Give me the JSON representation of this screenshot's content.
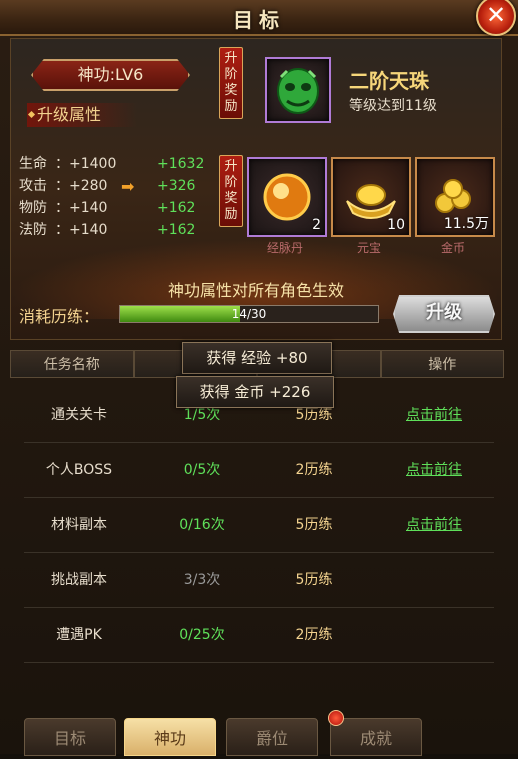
{
  "window": {
    "title": "目标",
    "close_label": "✕"
  },
  "level": {
    "label": "神功:LV6"
  },
  "attributes": {
    "section_label": "升级属性",
    "stats": [
      {
        "name": "生命",
        "current": "+1400",
        "next": "+1632"
      },
      {
        "name": "攻击",
        "current": "+280",
        "next": "+326"
      },
      {
        "name": "物防",
        "current": "+140",
        "next": "+162"
      },
      {
        "name": "法防",
        "current": "+140",
        "next": "+162"
      }
    ]
  },
  "advance_reward": {
    "badge": "升阶奖励",
    "title": "二阶天珠",
    "subtitle": "等级达到11级"
  },
  "upgrade_reward": {
    "badge": "升阶奖励",
    "items": [
      {
        "name": "经脉丹",
        "count": "2"
      },
      {
        "name": "元宝",
        "count": "10"
      },
      {
        "name": "金币",
        "count": "11.5万"
      }
    ]
  },
  "effect_text": "神功属性对所有角色生效",
  "consume": {
    "label": "消耗历练：",
    "progress_text": "14/30",
    "progress_fraction": 0.4667
  },
  "upgrade_button": "升级",
  "table": {
    "headers": [
      "任务名称",
      "",
      "励",
      "操作"
    ],
    "rows": [
      {
        "name": "通关关卡",
        "progress": "1/5次",
        "reward": "5历练",
        "action": "点击前往"
      },
      {
        "name": "个人BOSS",
        "progress": "0/5次",
        "reward": "2历练",
        "action": "点击前往"
      },
      {
        "name": "材料副本",
        "progress": "0/16次",
        "reward": "5历练",
        "action": "点击前往"
      },
      {
        "name": "挑战副本",
        "progress": "3/3次",
        "reward": "5历练",
        "action": ""
      },
      {
        "name": "遭遇PK",
        "progress": "0/25次",
        "reward": "2历练",
        "action": ""
      }
    ]
  },
  "toasts": [
    "获得  经验  +80",
    "获得  金币  +226"
  ],
  "tabs": [
    {
      "label": "目标",
      "active": false
    },
    {
      "label": "神功",
      "active": true
    },
    {
      "label": "爵位",
      "active": false
    },
    {
      "label": "成就",
      "active": false
    }
  ],
  "colors": {
    "accent_green": "#5fe05a",
    "title_gold": "#f6d67a",
    "tab_active": "#d9b06a"
  }
}
